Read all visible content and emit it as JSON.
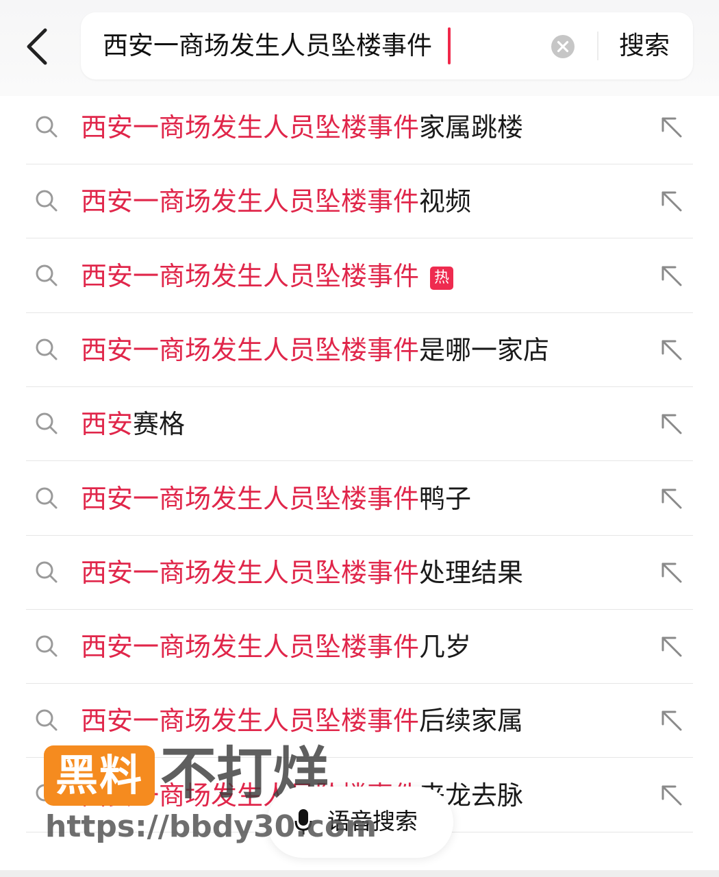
{
  "search": {
    "query": "西安一商场发生人员坠楼事件",
    "submit_label": "搜索"
  },
  "suggestions": [
    {
      "highlight": "西安一商场发生人员坠楼事件",
      "rest": "家属跳楼",
      "hot": false
    },
    {
      "highlight": "西安一商场发生人员坠楼事件",
      "rest": "视频",
      "hot": false
    },
    {
      "highlight": "西安一商场发生人员坠楼事件",
      "rest": "",
      "hot": true,
      "badge": "热"
    },
    {
      "highlight": "西安一商场发生人员坠楼事件",
      "rest": "是哪一家店",
      "hot": false
    },
    {
      "highlight": "西安",
      "rest": "赛格",
      "hot": false
    },
    {
      "highlight": "西安一商场发生人员坠楼事件",
      "rest": "鸭子",
      "hot": false
    },
    {
      "highlight": "西安一商场发生人员坠楼事件",
      "rest": "处理结果",
      "hot": false
    },
    {
      "highlight": "西安一商场发生人员坠楼事件",
      "rest": "几岁",
      "hot": false
    },
    {
      "highlight": "西安一商场发生人员坠楼事件",
      "rest": "后续家属",
      "hot": false
    },
    {
      "highlight": "西安一商场发生人员坠楼事件",
      "rest": "来龙去脉",
      "hot": false
    }
  ],
  "voice_search": {
    "label": "语音搜索"
  },
  "watermark": {
    "badge": "黑料",
    "text": "不打烊",
    "url": "https://bbdy30.com"
  },
  "colors": {
    "highlight": "#e0264a",
    "caret": "#f0284a",
    "hot_badge": "#ee2b4f",
    "watermark_badge": "#f58b1f"
  }
}
